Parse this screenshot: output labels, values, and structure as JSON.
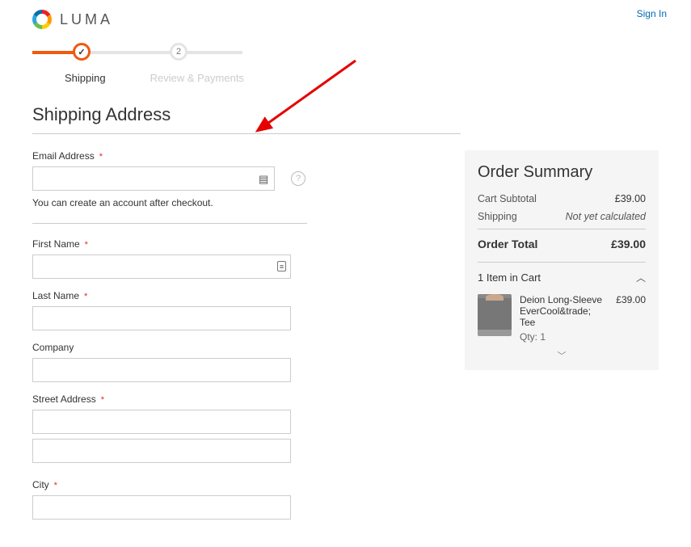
{
  "header": {
    "logo_text": "LUMA",
    "sign_in": "Sign In"
  },
  "progress": {
    "step1": {
      "label": "Shipping",
      "icon": "✓"
    },
    "step2": {
      "label": "Review & Payments",
      "number": "2"
    }
  },
  "section": {
    "title": "Shipping Address"
  },
  "form": {
    "email_label": "Email Address",
    "email_value": "",
    "email_hint": "You can create an account after checkout.",
    "first_name_label": "First Name",
    "first_name_value": "",
    "last_name_label": "Last Name",
    "last_name_value": "",
    "company_label": "Company",
    "company_value": "",
    "street_label": "Street Address",
    "street_value_1": "",
    "street_value_2": "",
    "city_label": "City",
    "city_value": ""
  },
  "summary": {
    "title": "Order Summary",
    "subtotal_label": "Cart Subtotal",
    "subtotal_value": "£39.00",
    "shipping_label": "Shipping",
    "shipping_value": "Not yet calculated",
    "total_label": "Order Total",
    "total_value": "£39.00",
    "cart_count_label": "1 Item in Cart",
    "item": {
      "name": "Deion Long-Sleeve EverCool&trade; Tee",
      "qty_label": "Qty: 1",
      "price": "£39.00"
    }
  }
}
